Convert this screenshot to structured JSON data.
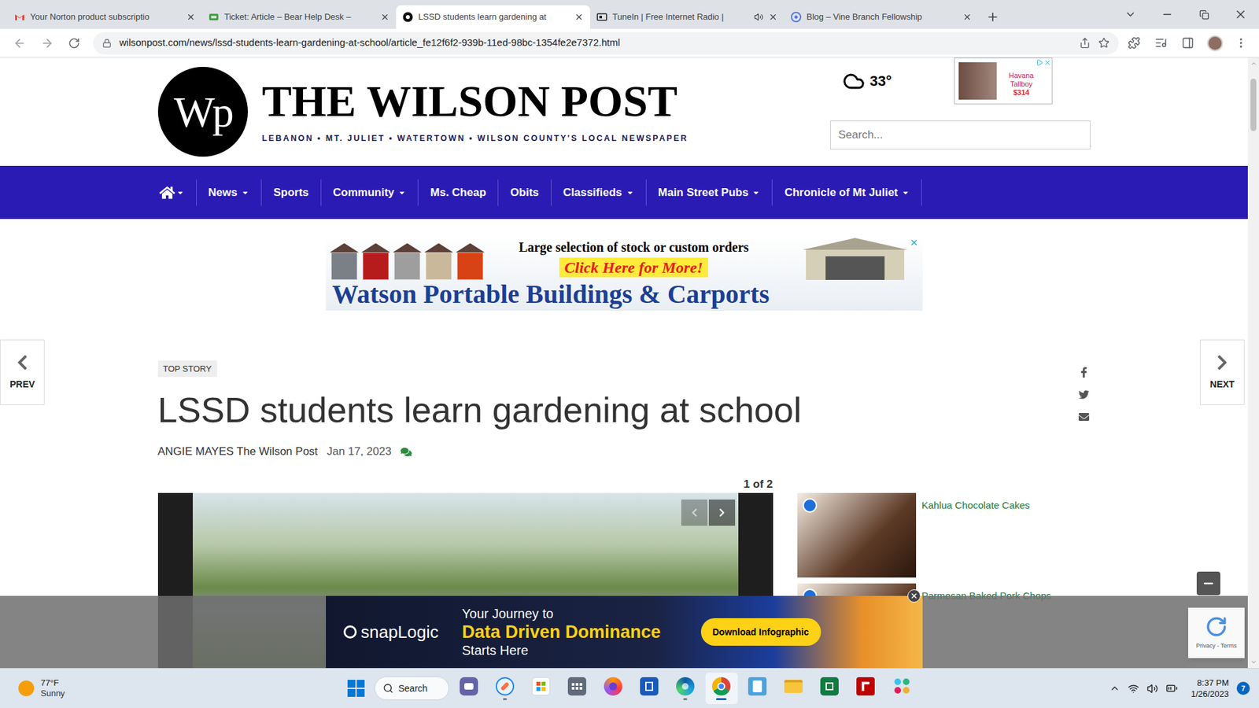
{
  "browser": {
    "tabs": [
      {
        "label": "Your Norton product subscriptio",
        "selected": false,
        "audio": false,
        "kind": "gmail"
      },
      {
        "label": "Ticket: Article – Bear Help Desk –",
        "selected": false,
        "audio": false,
        "kind": "helpdesk"
      },
      {
        "label": "LSSD students learn gardening at",
        "selected": true,
        "audio": false,
        "kind": "wilsonpost"
      },
      {
        "label": "TuneIn | Free Internet Radio |",
        "selected": false,
        "audio": true,
        "kind": "tunein"
      },
      {
        "label": "Blog – Vine Branch Fellowship",
        "selected": false,
        "audio": false,
        "kind": "vine"
      }
    ],
    "url": "wilsonpost.com/news/lssd-students-learn-gardening-at-school/article_fe12f6f2-939b-11ed-98bc-1354fe2e7372.html"
  },
  "header": {
    "logo_mark": "Wp",
    "title": "THE WILSON POST",
    "tagline": "LEBANON • MT. JULIET • WATERTOWN • WILSON COUNTY'S LOCAL NEWSPAPER",
    "weather": "33°",
    "ad": {
      "text": "Havana Tallboy",
      "price": "$314"
    },
    "search_placeholder": "Search..."
  },
  "nav": {
    "home_dropdown": true,
    "items": [
      {
        "label": "News",
        "dropdown": true
      },
      {
        "label": "Sports",
        "dropdown": false
      },
      {
        "label": "Community",
        "dropdown": true
      },
      {
        "label": "Ms. Cheap",
        "dropdown": false
      },
      {
        "label": "Obits",
        "dropdown": false
      },
      {
        "label": "Classifieds",
        "dropdown": true
      },
      {
        "label": "Main Street Pubs",
        "dropdown": true
      },
      {
        "label": "Chronicle of Mt Juliet",
        "dropdown": true
      }
    ]
  },
  "banner_ad": {
    "line1": "Large selection of stock or custom orders",
    "cta": "Click Here for More!",
    "brand": "Watson Portable Buildings & Carports"
  },
  "pager": {
    "prev": "PREV",
    "next": "NEXT"
  },
  "article": {
    "badge": "TOP STORY",
    "title": "LSSD students learn gardening at school",
    "author": "ANGIE MAYES The Wilson Post",
    "date": "Jan 17, 2023",
    "gallery_count": "1 of 2"
  },
  "sidebar": [
    {
      "title": "Kahlua Chocolate Cakes"
    },
    {
      "title": "Parmesan Baked Pork Chops"
    }
  ],
  "bottom_ad": {
    "brand": "snapLogic",
    "line1": "Your Journey to",
    "line2": "Data Driven Dominance",
    "line3": "Starts Here",
    "button": "Download Infographic"
  },
  "recaptcha": "Privacy - Terms",
  "taskbar": {
    "weather_temp": "77°F",
    "weather_text": "Sunny",
    "search": "Search",
    "apps": [
      {
        "kind": "teams",
        "running": false,
        "focused": false
      },
      {
        "kind": "paint",
        "running": true,
        "focused": false
      },
      {
        "kind": "store",
        "running": false,
        "focused": false
      },
      {
        "kind": "calculator",
        "running": false,
        "focused": false
      },
      {
        "kind": "firefox",
        "running": false,
        "focused": false
      },
      {
        "kind": "word",
        "running": false,
        "focused": false
      },
      {
        "kind": "edge",
        "running": true,
        "focused": false
      },
      {
        "kind": "chrome",
        "running": true,
        "focused": true
      },
      {
        "kind": "notepad",
        "running": false,
        "focused": false
      },
      {
        "kind": "explorer",
        "running": false,
        "focused": false
      },
      {
        "kind": "excel",
        "running": false,
        "focused": false
      },
      {
        "kind": "filezilla",
        "running": false,
        "focused": false
      },
      {
        "kind": "slack",
        "running": false,
        "focused": false
      }
    ],
    "time": "8:37 PM",
    "date": "1/26/2023",
    "notifications": "7"
  }
}
